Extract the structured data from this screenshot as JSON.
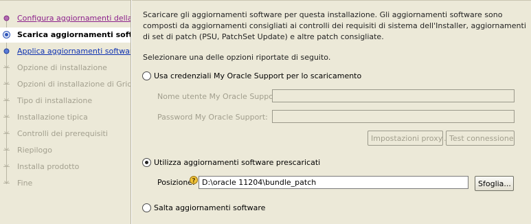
{
  "steps": [
    {
      "label": "Configura aggiornamenti della sicurezza",
      "state": "visited"
    },
    {
      "label": "Scarica aggiornamenti software",
      "state": "current"
    },
    {
      "label": "Applica aggiornamenti software",
      "state": "done"
    },
    {
      "label": "Opzione di installazione",
      "state": "future"
    },
    {
      "label": "Opzioni di installazione di Grid Infrastructure",
      "state": "future"
    },
    {
      "label": "Tipo di installazione",
      "state": "future"
    },
    {
      "label": "Installazione tipica",
      "state": "future"
    },
    {
      "label": "Controlli dei prerequisiti",
      "state": "future"
    },
    {
      "label": "Riepilogo",
      "state": "future"
    },
    {
      "label": "Installa prodotto",
      "state": "future"
    },
    {
      "label": "Fine",
      "state": "future"
    }
  ],
  "content": {
    "description": "Scaricare gli aggiornamenti software per questa installazione. Gli aggiornamenti software sono composti da aggiornamenti consigliati ai controlli dei requisiti di sistema dell'Installer, aggiornamenti di set di patch (PSU, PatchSet Update) e altre patch consigliate.",
    "select_prompt": "Selezionare una delle opzioni riportate di seguito.",
    "option_mos": "Usa credenziali My Oracle Support per lo scaricamento",
    "mos_user_label": "Nome utente My Oracle Support:",
    "mos_user_value": "",
    "mos_password_label": "Password My Oracle Support:",
    "mos_password_value": "",
    "proxy_button": "Impostazioni proxy...",
    "test_button": "Test connessione",
    "option_predownloaded": "Utilizza aggiornamenti software prescaricati",
    "location_label": "Posizione:",
    "location_value": "D:\\oracle 11204\\bundle_patch",
    "browse_button": "Sfoglia...",
    "option_skip": "Salta aggiornamenti software",
    "selected_option": "predownloaded"
  }
}
